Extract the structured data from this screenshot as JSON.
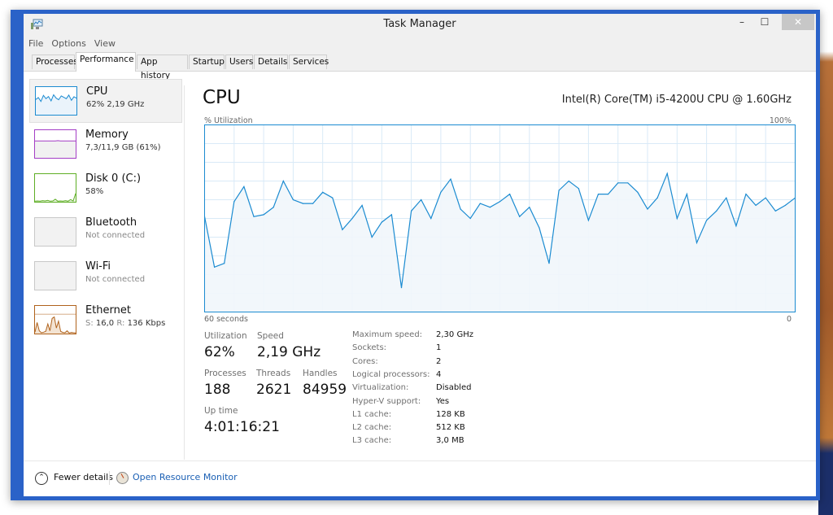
{
  "window": {
    "title": "Task Manager",
    "controls": {
      "minimize": "–",
      "maximize": "☐",
      "close": "✕"
    }
  },
  "menu": [
    "File",
    "Options",
    "View"
  ],
  "tabs": [
    {
      "label": "Processes",
      "active": false
    },
    {
      "label": "Performance",
      "active": true
    },
    {
      "label": "App history",
      "active": false
    },
    {
      "label": "Startup",
      "active": false
    },
    {
      "label": "Users",
      "active": false
    },
    {
      "label": "Details",
      "active": false
    },
    {
      "label": "Services",
      "active": false
    }
  ],
  "sidebar": {
    "items": [
      {
        "name": "CPU",
        "sub": "62% 2,19 GHz",
        "color": "#1b8bd1",
        "selected": true
      },
      {
        "name": "Memory",
        "sub": "7,3/11,9 GB (61%)",
        "color": "#a43ec6",
        "selected": false
      },
      {
        "name": "Disk 0 (C:)",
        "sub": "58%",
        "color": "#5eae25",
        "selected": false
      },
      {
        "name": "Bluetooth",
        "sub": "Not connected",
        "color": "#c8c8c8",
        "selected": false
      },
      {
        "name": "Wi-Fi",
        "sub": "Not connected",
        "color": "#c8c8c8",
        "selected": false
      },
      {
        "name": "Ethernet",
        "sub_s_label": "S:",
        "sub_s_val": "16,0",
        "sub_r_label": "R:",
        "sub_r_val": "136 Kbps",
        "color": "#b0621c",
        "selected": false
      }
    ]
  },
  "main": {
    "title": "CPU",
    "model": "Intel(R) Core(TM) i5-4200U CPU @ 1.60GHz",
    "graph_label": "% Utilization",
    "graph_max": "100%",
    "x_left": "60 seconds",
    "x_right": "0",
    "stats": {
      "utilization_label": "Utilization",
      "utilization": "62%",
      "speed_label": "Speed",
      "speed": "2,19 GHz",
      "processes_label": "Processes",
      "processes": "188",
      "threads_label": "Threads",
      "threads": "2621",
      "handles_label": "Handles",
      "handles": "84959",
      "uptime_label": "Up time",
      "uptime": "4:01:16:21"
    },
    "specs": [
      {
        "k": "Maximum speed:",
        "v": "2,30 GHz"
      },
      {
        "k": "Sockets:",
        "v": "1"
      },
      {
        "k": "Cores:",
        "v": "2"
      },
      {
        "k": "Logical processors:",
        "v": "4"
      },
      {
        "k": "Virtualization:",
        "v": "Disabled"
      },
      {
        "k": "Hyper-V support:",
        "v": "Yes"
      },
      {
        "k": "L1 cache:",
        "v": "128 KB"
      },
      {
        "k": "L2 cache:",
        "v": "512 KB"
      },
      {
        "k": "L3 cache:",
        "v": "3,0 MB"
      }
    ]
  },
  "footer": {
    "fewer_details": "Fewer details",
    "open_resource_monitor": "Open Resource Monitor"
  },
  "chart_data": {
    "type": "area",
    "title": "% Utilization",
    "xlabel_left": "60 seconds",
    "xlabel_right": "0",
    "ylim": [
      0,
      100
    ],
    "xlim": [
      60,
      0
    ],
    "grid": true,
    "line_color": "#1b8bd1",
    "fill_color": "#f1f6fb",
    "grid_color": "#d9eaf7",
    "x": [
      60,
      59,
      58,
      57,
      56,
      55,
      54,
      53,
      52,
      51,
      50,
      49,
      48,
      47,
      46,
      45,
      44,
      43,
      42,
      41,
      40,
      39,
      38,
      37,
      36,
      35,
      34,
      33,
      32,
      31,
      30,
      29,
      28,
      27,
      26,
      25,
      24,
      23,
      22,
      21,
      20,
      19,
      18,
      17,
      16,
      15,
      14,
      13,
      12,
      11,
      10,
      9,
      8,
      7,
      6,
      5,
      4,
      3,
      2,
      1,
      0
    ],
    "values": [
      51,
      24,
      26,
      59,
      67,
      51,
      52,
      56,
      70,
      60,
      58,
      58,
      64,
      61,
      44,
      50,
      57,
      40,
      48,
      52,
      13,
      54,
      60,
      50,
      64,
      71,
      55,
      50,
      58,
      56,
      59,
      63,
      51,
      56,
      45,
      26,
      65,
      70,
      66,
      49,
      63,
      63,
      69,
      69,
      64,
      55,
      61,
      74,
      50,
      63,
      37,
      49,
      54,
      61,
      46,
      63,
      57,
      61,
      54,
      57,
      61
    ],
    "sidebar_mini": {
      "cpu": [
        55,
        62,
        48,
        70,
        58,
        66,
        50,
        72,
        60,
        54,
        68,
        63,
        58,
        71,
        52,
        65,
        60
      ],
      "memory": [
        61,
        61,
        61,
        61,
        61,
        61,
        61,
        61,
        61,
        62,
        61,
        61,
        61,
        61,
        61,
        61,
        61
      ],
      "disk": [
        2,
        3,
        2,
        4,
        3,
        5,
        2,
        3,
        9,
        2,
        3,
        2,
        4,
        2,
        8,
        3,
        30
      ],
      "ethernet": [
        5,
        40,
        10,
        3,
        5,
        8,
        35,
        10,
        55,
        60,
        20,
        45,
        8,
        4,
        3,
        10,
        2,
        4,
        3,
        2
      ]
    }
  }
}
